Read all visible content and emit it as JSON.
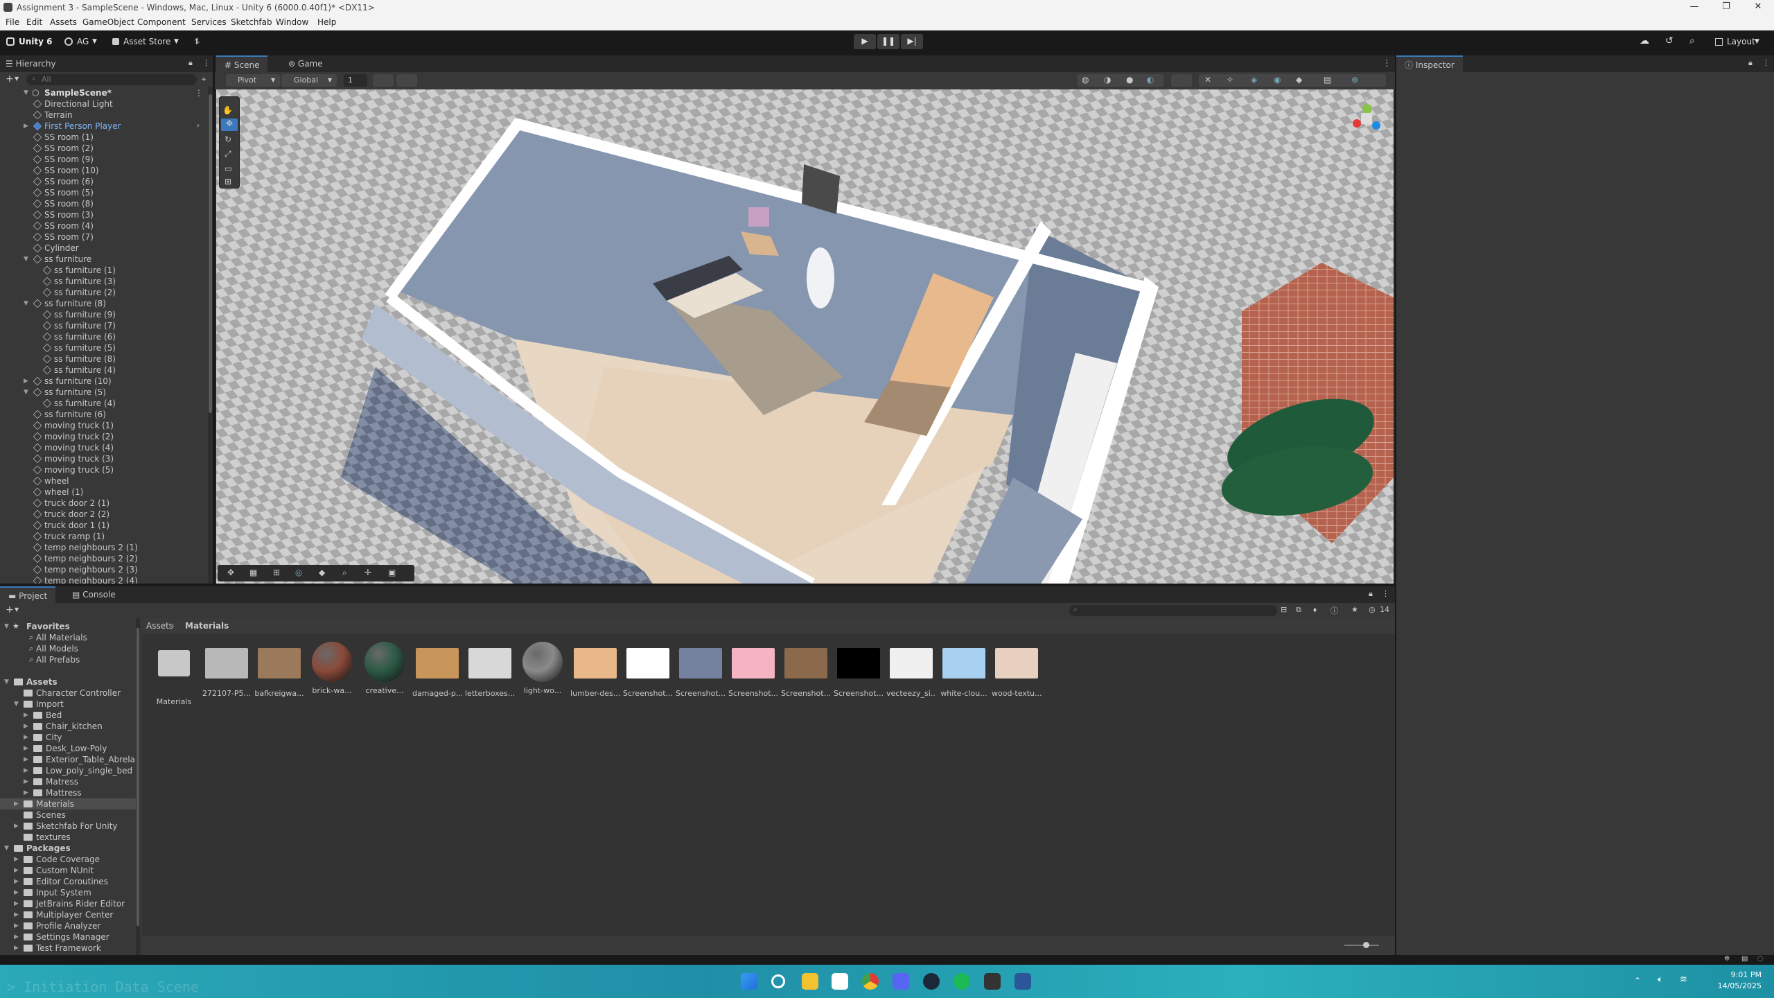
{
  "window": {
    "title": "Assignment 3 - SampleScene - Windows, Mac, Linux - Unity 6 (6000.0.40f1)* <DX11>"
  },
  "menu": [
    "File",
    "Edit",
    "Assets",
    "GameObject",
    "Component",
    "Services",
    "Sketchfab",
    "Window",
    "Help"
  ],
  "toolbar": {
    "unity_label": "Unity 6",
    "account_label": "AG",
    "asset_store_label": "Asset Store",
    "layout_label": "Layout"
  },
  "hierarchy": {
    "tab": "Hierarchy",
    "search_placeholder": "All",
    "scene_name": "SampleScene*",
    "items": [
      {
        "label": "Directional Light",
        "indent": 1
      },
      {
        "label": "Terrain",
        "indent": 1
      },
      {
        "label": "First Person Player",
        "indent": 1,
        "prefab": true,
        "arrow": "collapsed"
      },
      {
        "label": "SS room (1)",
        "indent": 1
      },
      {
        "label": "SS room (2)",
        "indent": 1
      },
      {
        "label": "SS room (9)",
        "indent": 1
      },
      {
        "label": "SS room (10)",
        "indent": 1
      },
      {
        "label": "SS room (6)",
        "indent": 1
      },
      {
        "label": "SS room (5)",
        "indent": 1
      },
      {
        "label": "SS room (8)",
        "indent": 1
      },
      {
        "label": "SS room (3)",
        "indent": 1
      },
      {
        "label": "SS room (4)",
        "indent": 1
      },
      {
        "label": "SS room (7)",
        "indent": 1
      },
      {
        "label": "Cylinder",
        "indent": 1
      },
      {
        "label": "ss furniture",
        "indent": 1,
        "arrow": "expanded"
      },
      {
        "label": "ss furniture (1)",
        "indent": 2
      },
      {
        "label": "ss furniture (3)",
        "indent": 2
      },
      {
        "label": "ss furniture (2)",
        "indent": 2
      },
      {
        "label": "ss furniture (8)",
        "indent": 1,
        "arrow": "expanded"
      },
      {
        "label": "ss furniture (9)",
        "indent": 2
      },
      {
        "label": "ss furniture (7)",
        "indent": 2
      },
      {
        "label": "ss furniture (6)",
        "indent": 2
      },
      {
        "label": "ss furniture (5)",
        "indent": 2
      },
      {
        "label": "ss furniture (8)",
        "indent": 2
      },
      {
        "label": "ss furniture (4)",
        "indent": 2
      },
      {
        "label": "ss furniture (10)",
        "indent": 1,
        "arrow": "collapsed"
      },
      {
        "label": "ss furniture (5)",
        "indent": 1,
        "arrow": "expanded"
      },
      {
        "label": "ss furniture (4)",
        "indent": 2
      },
      {
        "label": "ss furniture (6)",
        "indent": 1
      },
      {
        "label": "moving truck (1)",
        "indent": 1
      },
      {
        "label": "moving truck (2)",
        "indent": 1
      },
      {
        "label": "moving truck (4)",
        "indent": 1
      },
      {
        "label": "moving truck (3)",
        "indent": 1
      },
      {
        "label": "moving truck (5)",
        "indent": 1
      },
      {
        "label": "wheel",
        "indent": 1
      },
      {
        "label": "wheel (1)",
        "indent": 1
      },
      {
        "label": "truck door 2 (1)",
        "indent": 1
      },
      {
        "label": "truck door 2 (2)",
        "indent": 1
      },
      {
        "label": "truck door 1 (1)",
        "indent": 1
      },
      {
        "label": "truck ramp (1)",
        "indent": 1
      },
      {
        "label": "temp neighbours 2 (1)",
        "indent": 1
      },
      {
        "label": "temp neighbours 2 (2)",
        "indent": 1
      },
      {
        "label": "temp neighbours 2 (3)",
        "indent": 1
      },
      {
        "label": "temp neighbours 2 (4)",
        "indent": 1
      }
    ]
  },
  "scene": {
    "tabs": [
      "Scene",
      "Game"
    ],
    "pivot_label": "Pivot",
    "global_label": "Global",
    "snap_value": "1",
    "gizmo_axis": "y"
  },
  "inspector": {
    "tab": "Inspector"
  },
  "project": {
    "tabs": [
      "Project",
      "Console"
    ],
    "search_placeholder": "",
    "count": "14",
    "breadcrumb": [
      "Assets",
      "Materials"
    ],
    "tree": [
      {
        "label": "Favorites",
        "indent": 0,
        "type": "header",
        "arrow": "expanded"
      },
      {
        "label": "All Materials",
        "indent": 1,
        "type": "search"
      },
      {
        "label": "All Models",
        "indent": 1,
        "type": "search"
      },
      {
        "label": "All Prefabs",
        "indent": 1,
        "type": "search"
      },
      {
        "label": "",
        "indent": 0,
        "type": "spacer"
      },
      {
        "label": "Assets",
        "indent": 0,
        "type": "header",
        "arrow": "expanded"
      },
      {
        "label": "Character Controller",
        "indent": 1,
        "type": "folder"
      },
      {
        "label": "Import",
        "indent": 1,
        "type": "folder",
        "arrow": "expanded"
      },
      {
        "label": "Bed",
        "indent": 2,
        "type": "folder",
        "arrow": "collapsed"
      },
      {
        "label": "Chair_kitchen",
        "indent": 2,
        "type": "folder",
        "arrow": "collapsed"
      },
      {
        "label": "City",
        "indent": 2,
        "type": "folder",
        "arrow": "collapsed"
      },
      {
        "label": "Desk_Low-Poly",
        "indent": 2,
        "type": "folder",
        "arrow": "collapsed"
      },
      {
        "label": "Exterior_Table_Abrela",
        "indent": 2,
        "type": "folder",
        "arrow": "collapsed"
      },
      {
        "label": "Low_poly_single_bed",
        "indent": 2,
        "type": "folder",
        "arrow": "collapsed"
      },
      {
        "label": "Matress",
        "indent": 2,
        "type": "folder",
        "arrow": "collapsed"
      },
      {
        "label": "Mattress",
        "indent": 2,
        "type": "folder",
        "arrow": "collapsed"
      },
      {
        "label": "Materials",
        "indent": 1,
        "type": "folder",
        "selected": true,
        "arrow": "collapsed"
      },
      {
        "label": "Scenes",
        "indent": 1,
        "type": "folder"
      },
      {
        "label": "Sketchfab For Unity",
        "indent": 1,
        "type": "folder",
        "arrow": "collapsed"
      },
      {
        "label": "textures",
        "indent": 1,
        "type": "folder"
      },
      {
        "label": "Packages",
        "indent": 0,
        "type": "header",
        "arrow": "expanded"
      },
      {
        "label": "Code Coverage",
        "indent": 1,
        "type": "folder",
        "arrow": "collapsed"
      },
      {
        "label": "Custom NUnit",
        "indent": 1,
        "type": "folder",
        "arrow": "collapsed"
      },
      {
        "label": "Editor Coroutines",
        "indent": 1,
        "type": "folder",
        "arrow": "collapsed"
      },
      {
        "label": "Input System",
        "indent": 1,
        "type": "folder",
        "arrow": "collapsed"
      },
      {
        "label": "JetBrains Rider Editor",
        "indent": 1,
        "type": "folder",
        "arrow": "collapsed"
      },
      {
        "label": "Multiplayer Center",
        "indent": 1,
        "type": "folder",
        "arrow": "collapsed"
      },
      {
        "label": "Profile Analyzer",
        "indent": 1,
        "type": "folder",
        "arrow": "collapsed"
      },
      {
        "label": "Settings Manager",
        "indent": 1,
        "type": "folder",
        "arrow": "collapsed"
      },
      {
        "label": "Test Framework",
        "indent": 1,
        "type": "folder",
        "arrow": "collapsed"
      }
    ],
    "assets": [
      {
        "label": "Materials",
        "kind": "folder"
      },
      {
        "label": "272107-P5...",
        "kind": "texture",
        "color": "#b8b8b8"
      },
      {
        "label": "bafkreigwa...",
        "kind": "texture",
        "color": "#9a7a5a"
      },
      {
        "label": "brick-wa...",
        "kind": "sphere",
        "color": "#8a4a3a"
      },
      {
        "label": "creative...",
        "kind": "sphere",
        "color": "#2d5a45"
      },
      {
        "label": "damaged-p...",
        "kind": "texture",
        "color": "#c8955a"
      },
      {
        "label": "letterboxes...",
        "kind": "texture",
        "color": "#d8d8d8"
      },
      {
        "label": "light-wo...",
        "kind": "sphere",
        "color": "#8a8a8a"
      },
      {
        "label": "lumber-des...",
        "kind": "texture",
        "color": "#e8b888"
      },
      {
        "label": "Screenshot...",
        "kind": "texture",
        "color": "#ffffff"
      },
      {
        "label": "Screenshot...",
        "kind": "texture",
        "color": "#7482a0"
      },
      {
        "label": "Screenshot...",
        "kind": "texture",
        "color": "#f4b4c4"
      },
      {
        "label": "Screenshot...",
        "kind": "texture",
        "color": "#8a6a4a"
      },
      {
        "label": "Screenshot...",
        "kind": "texture",
        "color": "#000000"
      },
      {
        "label": "vecteezy_si...",
        "kind": "texture",
        "color": "#f0f0f0"
      },
      {
        "label": "white-clou...",
        "kind": "texture",
        "color": "#a8d0f0"
      },
      {
        "label": "wood-textu...",
        "kind": "texture",
        "color": "#e8d0c0"
      }
    ]
  },
  "taskbar": {
    "time": "9:01 PM",
    "date": "14/05/2025"
  }
}
